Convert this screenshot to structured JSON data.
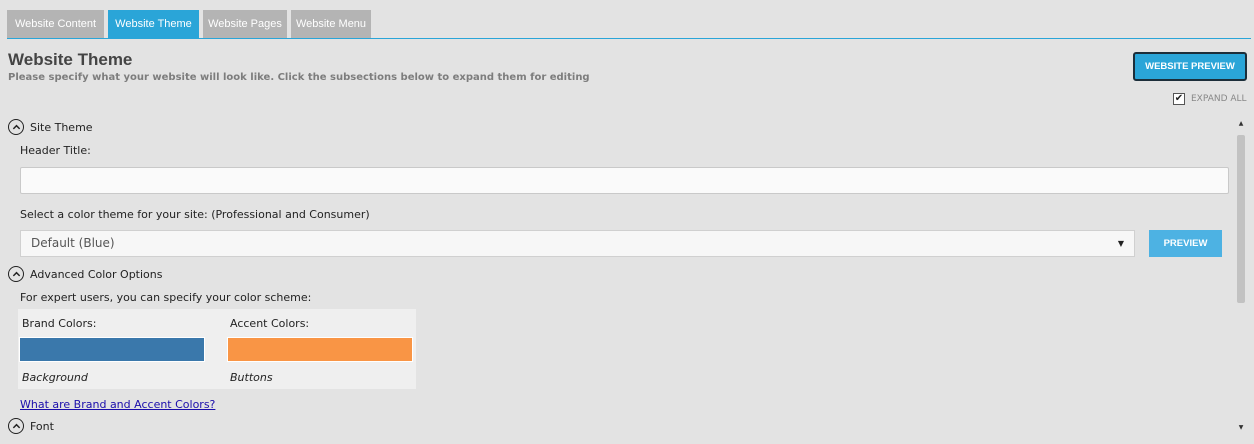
{
  "tabs": [
    {
      "label": "Website Content",
      "active": false
    },
    {
      "label": "Website Theme",
      "active": true
    },
    {
      "label": "Website Pages",
      "active": false
    },
    {
      "label": "Website Menu",
      "active": false
    }
  ],
  "header": {
    "title": "Website Theme",
    "subtitle": "Please specify what your website will look like. Click the subsections below to expand them for editing",
    "preview_button": "WEBSITE PREVIEW",
    "expand_all_label": "EXPAND ALL",
    "expand_all_checked": true
  },
  "site_theme": {
    "section_label": "Site Theme",
    "header_title_label": "Header Title:",
    "header_title_value": "",
    "color_theme_label": "Select a color theme for your site: (Professional and Consumer)",
    "color_theme_selected": "Default (Blue)",
    "preview_button": "PREVIEW"
  },
  "advanced_colors": {
    "section_label": "Advanced Color Options",
    "description": "For expert users, you can specify your color scheme:",
    "brand_label": "Brand Colors:",
    "brand_color": "#3a78ab",
    "brand_usage": "Background",
    "accent_label": "Accent Colors:",
    "accent_color": "#f99545",
    "accent_usage": "Buttons",
    "help_link": "What are Brand and Accent Colors?"
  },
  "font": {
    "section_label": "Font"
  },
  "icons": {
    "collapse": "chevron-up-circle-icon",
    "select_arrow": "caret-down-icon",
    "checkbox": "checkmark-icon"
  },
  "colors": {
    "accent": "#2aa5d8",
    "tab_inactive": "#b4b4b4",
    "background": "#e3e3e3"
  }
}
